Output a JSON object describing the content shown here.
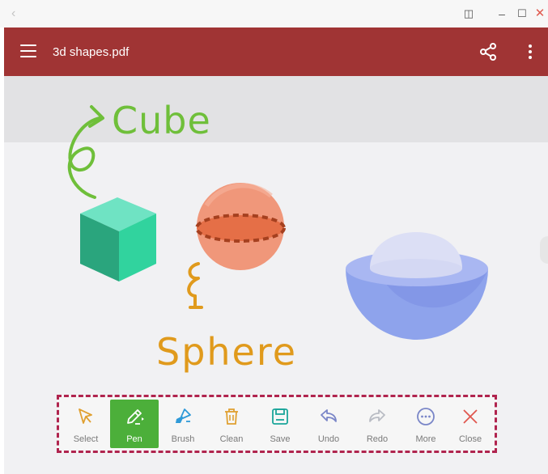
{
  "window": {
    "back_icon": "chevron-left-icon",
    "controls": {
      "split": "◫",
      "minimize": "–",
      "maximize": "☐",
      "close": "✕"
    }
  },
  "appbar": {
    "title": "3d shapes.pdf",
    "background": "#a03434",
    "menu_icon": "hamburger-menu-icon",
    "share_icon": "share-icon",
    "more_icon": "kebab-menu-icon"
  },
  "canvas": {
    "annotations": [
      {
        "text": "Cube",
        "color": "#6fbf3a"
      },
      {
        "text": "Sphere",
        "color": "#e09a1c"
      }
    ],
    "shapes": [
      "cube",
      "sphere",
      "hemisphere-bowl"
    ]
  },
  "toolbar": {
    "active_tool": "Pen",
    "active_color": "#4caf3a",
    "tools": [
      {
        "label": "Select",
        "icon": "cursor-arrow-icon"
      },
      {
        "label": "Pen",
        "icon": "pen-icon"
      },
      {
        "label": "Brush",
        "icon": "brush-icon"
      },
      {
        "label": "Clean",
        "icon": "trash-icon"
      },
      {
        "label": "Save",
        "icon": "save-icon"
      },
      {
        "label": "Undo",
        "icon": "undo-icon"
      },
      {
        "label": "Redo",
        "icon": "redo-icon"
      },
      {
        "label": "More",
        "icon": "more-dots-icon"
      },
      {
        "label": "Close",
        "icon": "close-icon"
      }
    ]
  }
}
